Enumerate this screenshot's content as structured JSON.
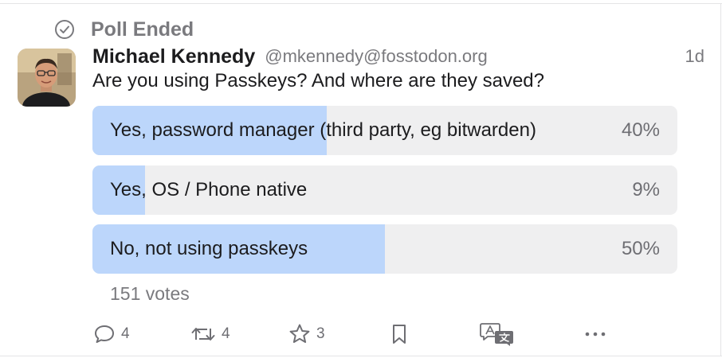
{
  "status": {
    "icon": "check-circle-icon",
    "label": "Poll Ended"
  },
  "post": {
    "author_name": "Michael Kennedy",
    "author_handle": "@mkennedy@fosstodon.org",
    "timestamp": "1d",
    "text": "Are you using Passkeys? And where are they saved?"
  },
  "poll": {
    "options": [
      {
        "label": "Yes, password manager (third party, eg bitwarden)",
        "percent_label": "40%",
        "percent": 40
      },
      {
        "label": "Yes, OS / Phone native",
        "percent_label": "9%",
        "percent": 9
      },
      {
        "label": "No, not using passkeys",
        "percent_label": "50%",
        "percent": 50
      }
    ],
    "votes_label": "151 votes"
  },
  "actions": {
    "reply": {
      "icon": "reply-icon",
      "count": "4"
    },
    "boost": {
      "icon": "boost-icon",
      "count": "4"
    },
    "favorite": {
      "icon": "star-icon",
      "count": "3"
    },
    "bookmark": {
      "icon": "bookmark-icon"
    },
    "translate": {
      "icon": "translate-icon"
    },
    "more": {
      "icon": "more-icon"
    }
  },
  "colors": {
    "poll_fill": "#bcd6fb",
    "poll_track": "#efeff0",
    "muted_text": "#7a7a7e"
  }
}
